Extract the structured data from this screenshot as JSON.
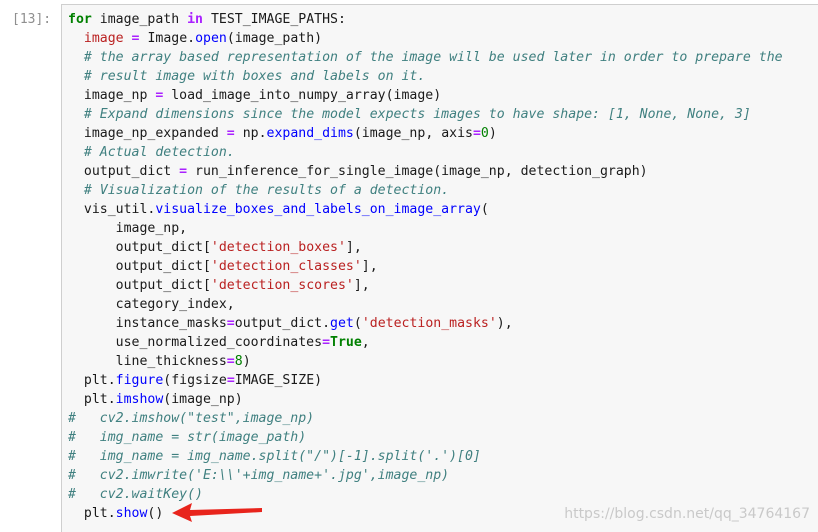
{
  "cell": {
    "prompt": "[13]:",
    "lines": [
      [
        [
          "kw",
          "for"
        ],
        [
          "var",
          " image_path "
        ],
        [
          "op",
          "in"
        ],
        [
          "var",
          " TEST_IMAGE_PATHS:"
        ]
      ],
      [
        [
          "var",
          "  "
        ],
        [
          "str",
          "image"
        ],
        [
          "var",
          " "
        ],
        [
          "op",
          "="
        ],
        [
          "var",
          " Image."
        ],
        [
          "attr",
          "open"
        ],
        [
          "var",
          "(image_path)"
        ]
      ],
      [
        [
          "var",
          "  "
        ],
        [
          "cm",
          "# the array based representation of the image will be used later in order to prepare the"
        ]
      ],
      [
        [
          "var",
          "  "
        ],
        [
          "cm",
          "# result image with boxes and labels on it."
        ]
      ],
      [
        [
          "var",
          "  image_np "
        ],
        [
          "op",
          "="
        ],
        [
          "var",
          " load_image_into_numpy_array(image)"
        ]
      ],
      [
        [
          "var",
          "  "
        ],
        [
          "cm",
          "# Expand dimensions since the model expects images to have shape: [1, None, None, 3]"
        ]
      ],
      [
        [
          "var",
          "  image_np_expanded "
        ],
        [
          "op",
          "="
        ],
        [
          "var",
          " np."
        ],
        [
          "attr",
          "expand_dims"
        ],
        [
          "var",
          "(image_np, axis"
        ],
        [
          "op",
          "="
        ],
        [
          "num",
          "0"
        ],
        [
          "var",
          ")"
        ]
      ],
      [
        [
          "var",
          "  "
        ],
        [
          "cm",
          "# Actual detection."
        ]
      ],
      [
        [
          "var",
          "  output_dict "
        ],
        [
          "op",
          "="
        ],
        [
          "var",
          " run_inference_for_single_image(image_np, detection_graph)"
        ]
      ],
      [
        [
          "var",
          "  "
        ],
        [
          "cm",
          "# Visualization of the results of a detection."
        ]
      ],
      [
        [
          "var",
          "  vis_util."
        ],
        [
          "attr",
          "visualize_boxes_and_labels_on_image_array"
        ],
        [
          "var",
          "("
        ]
      ],
      [
        [
          "var",
          "      image_np,"
        ]
      ],
      [
        [
          "var",
          "      output_dict["
        ],
        [
          "str",
          "'detection_boxes'"
        ],
        [
          "var",
          "],"
        ]
      ],
      [
        [
          "var",
          "      output_dict["
        ],
        [
          "str",
          "'detection_classes'"
        ],
        [
          "var",
          "],"
        ]
      ],
      [
        [
          "var",
          "      output_dict["
        ],
        [
          "str",
          "'detection_scores'"
        ],
        [
          "var",
          "],"
        ]
      ],
      [
        [
          "var",
          "      category_index,"
        ]
      ],
      [
        [
          "var",
          "      instance_masks"
        ],
        [
          "op",
          "="
        ],
        [
          "var",
          "output_dict."
        ],
        [
          "attr",
          "get"
        ],
        [
          "var",
          "("
        ],
        [
          "str",
          "'detection_masks'"
        ],
        [
          "var",
          "),"
        ]
      ],
      [
        [
          "var",
          "      use_normalized_coordinates"
        ],
        [
          "op",
          "="
        ],
        [
          "const",
          "True"
        ],
        [
          "var",
          ","
        ]
      ],
      [
        [
          "var",
          "      line_thickness"
        ],
        [
          "op",
          "="
        ],
        [
          "num",
          "8"
        ],
        [
          "var",
          ")"
        ]
      ],
      [
        [
          "var",
          "  plt."
        ],
        [
          "attr",
          "figure"
        ],
        [
          "var",
          "(figsize"
        ],
        [
          "op",
          "="
        ],
        [
          "var",
          "IMAGE_SIZE)"
        ]
      ],
      [
        [
          "var",
          "  plt."
        ],
        [
          "attr",
          "imshow"
        ],
        [
          "var",
          "(image_np)"
        ]
      ],
      [
        [
          "cm",
          "#   cv2.imshow(\"test\",image_np)"
        ]
      ],
      [
        [
          "cm",
          "#   img_name = str(image_path)"
        ]
      ],
      [
        [
          "cm",
          "#   img_name = img_name.split(\"/\")[-1].split('.')[0]"
        ]
      ],
      [
        [
          "cm",
          "#   cv2.imwrite('E:\\\\'+img_name+'.jpg',image_np)"
        ]
      ],
      [
        [
          "cm",
          "#   cv2.waitKey()"
        ]
      ],
      [
        [
          "var",
          "  plt."
        ],
        [
          "attr",
          "show"
        ],
        [
          "var",
          "()"
        ]
      ]
    ]
  },
  "watermark": "https://blog.csdn.net/qq_34764167",
  "colors": {
    "cell_bg": "#f7f7f7",
    "keyword": "#008000",
    "operator": "#aa22ff",
    "string": "#ba2121",
    "comment": "#408080",
    "attribute": "#0000ff",
    "arrow": "#e8241c"
  },
  "icons": {
    "arrow": "red-arrow-icon"
  }
}
